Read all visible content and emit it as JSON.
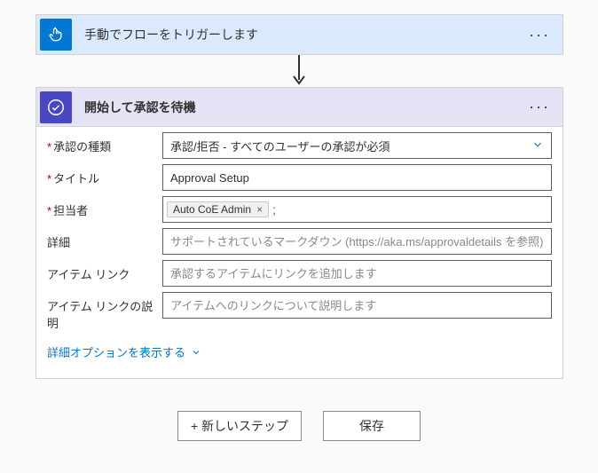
{
  "trigger": {
    "title": "手動でフローをトリガーします"
  },
  "action": {
    "title": "開始して承認を待機",
    "fields": {
      "approval_type": {
        "label": "承認の種類",
        "value": "承認/拒否 - すべてのユーザーの承認が必須"
      },
      "title": {
        "label": "タイトル",
        "value": "Approval Setup"
      },
      "assigned": {
        "label": "担当者",
        "token": "Auto CoE Admin"
      },
      "details": {
        "label": "詳細",
        "placeholder": "サポートされているマークダウン (https://aka.ms/approvaldetails を参照)"
      },
      "item_link": {
        "label": "アイテム リンク",
        "placeholder": "承認するアイテムにリンクを追加します"
      },
      "item_link_desc": {
        "label": "アイテム リンクの説明",
        "placeholder": "アイテムへのリンクについて説明します"
      }
    },
    "show_advanced": "詳細オプションを表示する"
  },
  "buttons": {
    "new_step": "+ 新しいステップ",
    "save": "保存"
  }
}
